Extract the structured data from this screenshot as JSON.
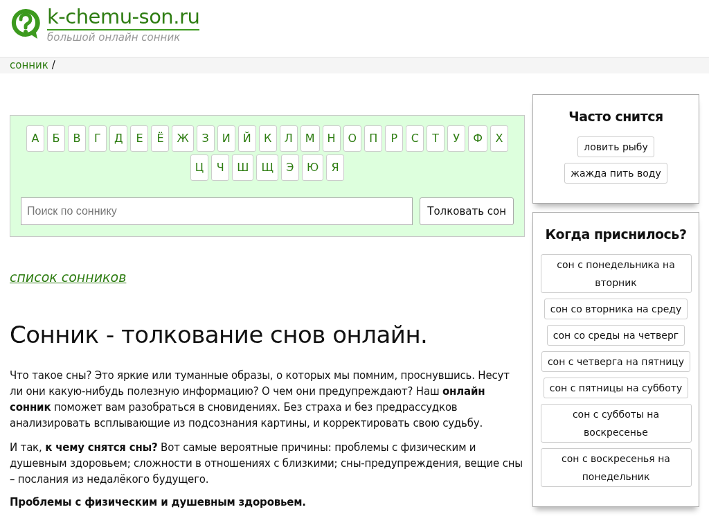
{
  "site": {
    "title": "k-chemu-son.ru",
    "tagline": "большой онлайн сонник"
  },
  "breadcrumb": {
    "link": "сонник",
    "separator": "/"
  },
  "alphabet": [
    "А",
    "Б",
    "В",
    "Г",
    "Д",
    "Е",
    "Ё",
    "Ж",
    "З",
    "И",
    "Й",
    "К",
    "Л",
    "М",
    "Н",
    "О",
    "П",
    "Р",
    "С",
    "Т",
    "У",
    "Ф",
    "Х",
    "Ц",
    "Ч",
    "Ш",
    "Щ",
    "Э",
    "Ю",
    "Я"
  ],
  "search": {
    "placeholder": "Поиск по соннику",
    "button": "Толковать сон"
  },
  "list_link": "список сонников",
  "heading": "Сонник - толкование снов онлайн.",
  "paragraphs": [
    "Что такое сны? Это яркие или туманные образы, о которых мы помним, проснувшись. Несут ли они какую-нибудь полезную информацию? О чем они предупреждают? Наш **онлайн сонник** поможет вам разобраться в сновидениях. Без страха и без предрассудков анализировать всплывающие из подсознания картины, и корректировать свою судьбу.",
    "И так, **к чему снятся сны?** Вот самые вероятные причины: проблемы с физическим и душевным здоровьем; сложности в отношениях с близкими; сны-предупреждения, вещие сны – послания из недалёкого будущего."
  ],
  "subheading": "Проблемы с физическим и душевным здоровьем.",
  "widgets": [
    {
      "title": "Часто снится",
      "items": [
        "ловить рыбу",
        "жажда пить воду"
      ]
    },
    {
      "title": "Когда приснилось?",
      "items": [
        "сон с понедельника на вторник",
        "сон со вторника на среду",
        "сон со среды на четверг",
        "сон с четверга на пятницу",
        "сон с пятницы на субботу",
        "сон с субботы на воскресенье",
        "сон с воскресенья на понедельник"
      ]
    }
  ]
}
